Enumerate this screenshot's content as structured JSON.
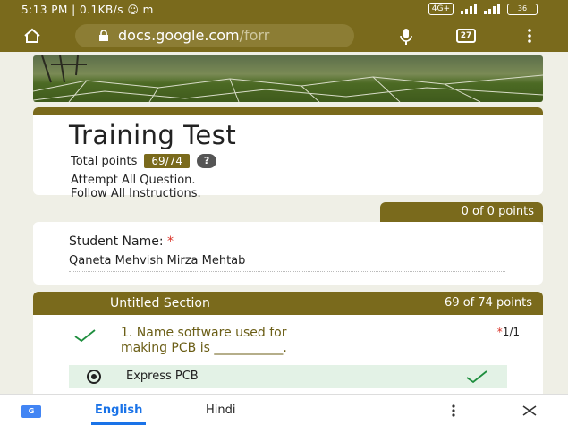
{
  "status_bar": {
    "time_info": "5:13 PM | 0.1KB/s ☺ m",
    "network": "4G+",
    "battery": "36"
  },
  "browser": {
    "url_main": "docs.google.com",
    "url_tail": "/forr",
    "tab_count": "27"
  },
  "form": {
    "title": "Training Test",
    "total_points_label": "Total points",
    "total_points_value": "69/74",
    "help": "?",
    "description_line1": "Attempt All Question.",
    "description_line2": "Follow All Instructions."
  },
  "points_tab": "0 of 0 points",
  "student_question": {
    "label": "Student Name:",
    "required_mark": "*",
    "answer": "Qaneta Mehvish Mirza Mehtab"
  },
  "section": {
    "title": "Untitled Section",
    "points": "69 of 74 points",
    "question_line1": "1. Name software used for",
    "question_line2": "making PCB is ___________.",
    "score_mark": "*",
    "score": "1/1",
    "selected_option": "Express PCB"
  },
  "translate_bar": {
    "active_lang": "English",
    "other_lang": "Hindi"
  },
  "colors": {
    "theme": "#7a6a1c",
    "correct": "#1e8e3e",
    "link": "#1a73e8"
  }
}
